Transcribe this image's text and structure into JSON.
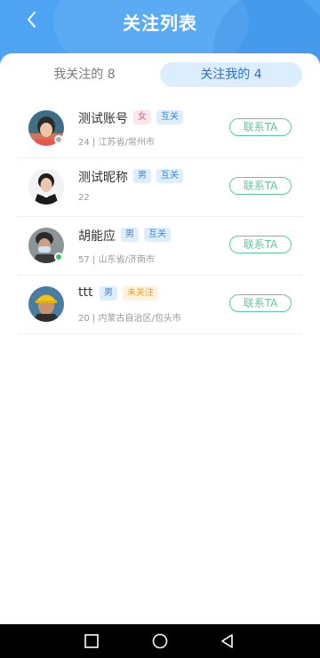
{
  "header": {
    "title": "关注列表",
    "bg_color": "#4ea3f3"
  },
  "tabs": [
    {
      "label": "我关注的 8",
      "active": false
    },
    {
      "label": "关注我的 4",
      "active": true
    }
  ],
  "users": [
    {
      "name": "测试账号",
      "gender": "女",
      "relation": "互关",
      "meta": "24 | 江苏省/常州市",
      "status": "offline",
      "contact_label": "联系TA"
    },
    {
      "name": "测试昵称",
      "gender": "男",
      "relation": "互关",
      "meta": "22",
      "status": "none",
      "contact_label": "联系TA"
    },
    {
      "name": "胡能应",
      "gender": "男",
      "relation": "互关",
      "meta": "57 | 山东省/济南市",
      "status": "online",
      "contact_label": "联系TA"
    },
    {
      "name": "ttt",
      "gender": "男",
      "relation": "未关注",
      "meta": "20 | 内蒙古自治区/包头市",
      "status": "none",
      "contact_label": "联系TA"
    }
  ],
  "colors": {
    "online": "#38c46f",
    "offline": "#b0b0b0",
    "contact": "#5cc9a1"
  },
  "navbar": {
    "icons": [
      "square-icon",
      "circle-icon",
      "back-triangle-icon"
    ]
  }
}
